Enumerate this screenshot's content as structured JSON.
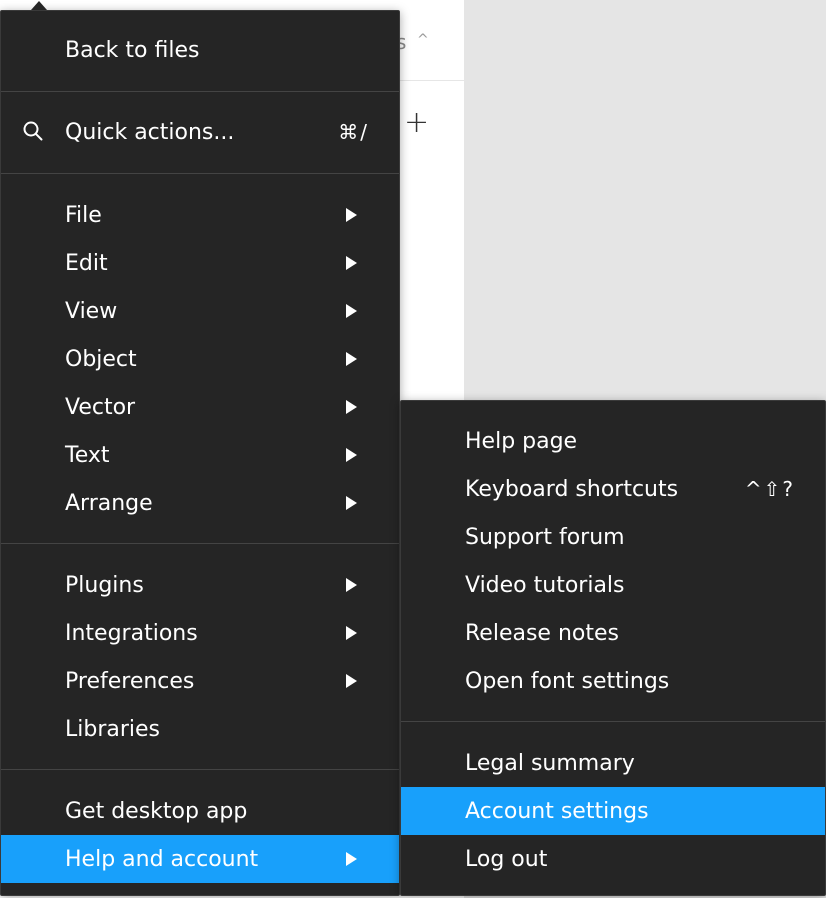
{
  "background": {
    "tab_text": "s",
    "chevron": "^",
    "plus": "+"
  },
  "main_menu": {
    "back": "Back to files",
    "quick_actions": {
      "label": "Quick actions...",
      "shortcut": "⌘/"
    },
    "groups": [
      [
        "File",
        "Edit",
        "View",
        "Object",
        "Vector",
        "Text",
        "Arrange"
      ],
      [
        "Plugins",
        "Integrations",
        "Preferences",
        "Libraries"
      ],
      [
        "Get desktop app",
        "Help and account"
      ]
    ],
    "active_item": "Help and account"
  },
  "submenu": {
    "help_page": "Help page",
    "keyboard_shortcuts": {
      "label": "Keyboard shortcuts",
      "shortcut": "^⇧?"
    },
    "support_forum": "Support forum",
    "video_tutorials": "Video tutorials",
    "release_notes": "Release notes",
    "open_font_settings": "Open font settings",
    "legal_summary": "Legal summary",
    "account_settings": "Account settings",
    "log_out": "Log out",
    "active_item": "Account settings"
  },
  "colors": {
    "menu_bg": "#252525",
    "highlight": "#18a0fb",
    "canvas": "#e5e5e5"
  },
  "icons": {
    "search": "search-icon",
    "submenu_arrow": "chevron-right-icon"
  }
}
